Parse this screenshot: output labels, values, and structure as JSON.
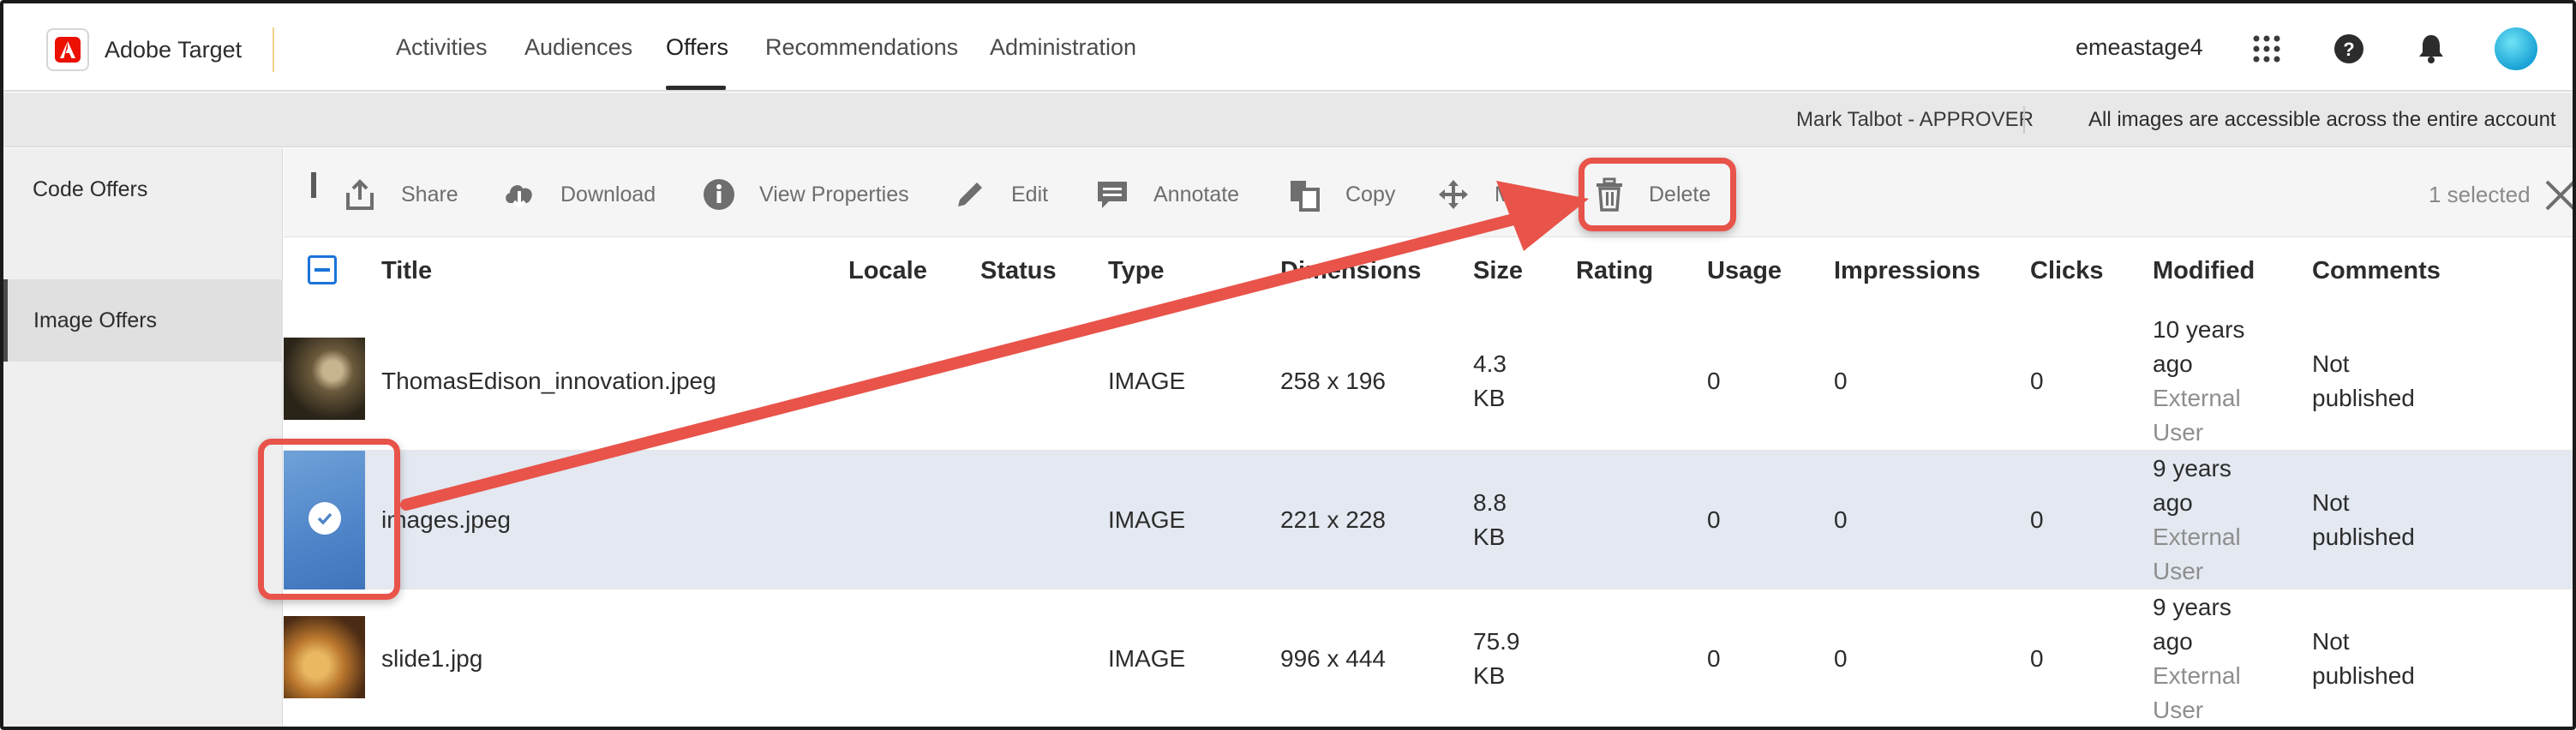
{
  "brand": {
    "name": "Adobe Target"
  },
  "nav": {
    "items": [
      {
        "label": "Activities"
      },
      {
        "label": "Audiences"
      },
      {
        "label": "Offers"
      },
      {
        "label": "Recommendations"
      },
      {
        "label": "Administration"
      }
    ],
    "active": "Offers"
  },
  "topbar": {
    "org": "emeastage4",
    "icons": [
      "apps-grid-icon",
      "help-icon",
      "bell-icon",
      "avatar"
    ]
  },
  "infobar": {
    "user": "Mark Talbot - APPROVER",
    "note": "All images are accessible across the entire account"
  },
  "sidebar": {
    "items": [
      {
        "label": "Code Offers"
      },
      {
        "label": "Image Offers"
      }
    ],
    "active": "Image Offers"
  },
  "toolbar": {
    "share": "Share",
    "download": "Download",
    "view_properties": "View Properties",
    "edit": "Edit",
    "annotate": "Annotate",
    "copy": "Copy",
    "move": "Move",
    "delete": "Delete",
    "selected_count": "1 selected"
  },
  "table": {
    "columns": [
      "Title",
      "Locale",
      "Status",
      "Type",
      "Dimensions",
      "Size",
      "Rating",
      "Usage",
      "Impressions",
      "Clicks",
      "Modified",
      "Comments"
    ],
    "rows": [
      {
        "title": "ThomasEdison_innovation.jpeg",
        "locale": "",
        "status": "",
        "type": "IMAGE",
        "dimensions": "258 x 196",
        "size_1": "4.3",
        "size_2": "KB",
        "rating": "",
        "usage": "0",
        "impressions": "0",
        "clicks": "0",
        "modified_1": "10 years",
        "modified_2": "ago",
        "modified_by_1": "External",
        "modified_by_2": "User",
        "comments_1": "Not",
        "comments_2": "published",
        "selected": false
      },
      {
        "title": "images.jpeg",
        "locale": "",
        "status": "",
        "type": "IMAGE",
        "dimensions": "221 x 228",
        "size_1": "8.8",
        "size_2": "KB",
        "rating": "",
        "usage": "0",
        "impressions": "0",
        "clicks": "0",
        "modified_1": "9 years",
        "modified_2": "ago",
        "modified_by_1": "External",
        "modified_by_2": "User",
        "comments_1": "Not",
        "comments_2": "published",
        "selected": true
      },
      {
        "title": "slide1.jpg",
        "locale": "",
        "status": "",
        "type": "IMAGE",
        "dimensions": "996 x 444",
        "size_1": "75.9",
        "size_2": "KB",
        "rating": "",
        "usage": "0",
        "impressions": "0",
        "clicks": "0",
        "modified_1": "9 years",
        "modified_2": "ago",
        "modified_by_1": "External",
        "modified_by_2": "User",
        "comments_1": "Not",
        "comments_2": "published",
        "selected": false
      }
    ]
  },
  "colors": {
    "accent": "#1a73d9",
    "annotation": "#e8534a",
    "selected_row": "#e3e8f1",
    "adobe_red": "#eb1000"
  }
}
